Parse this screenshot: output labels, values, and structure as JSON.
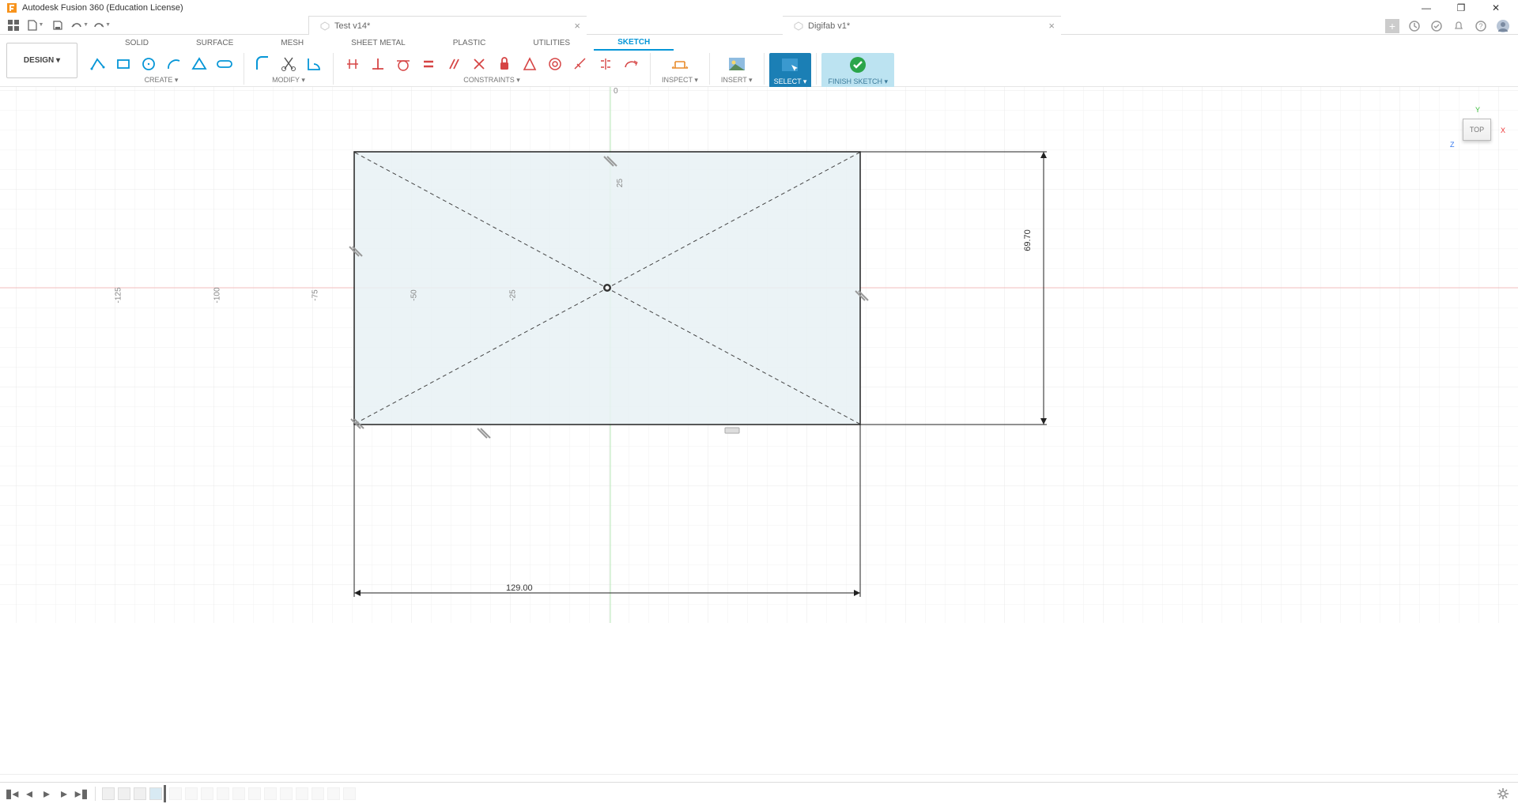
{
  "title_bar": {
    "title": "Autodesk Fusion 360 (Education License)"
  },
  "doc_tabs": {
    "tab1": {
      "label": "Test v14*"
    },
    "tab2": {
      "label": "Digifab v1*"
    }
  },
  "design_button": {
    "label": "DESIGN ▾"
  },
  "ribbon_tabs": {
    "solid": "SOLID",
    "surface": "SURFACE",
    "mesh": "MESH",
    "sheet_metal": "SHEET METAL",
    "plastic": "PLASTIC",
    "utilities": "UTILITIES",
    "sketch": "SKETCH"
  },
  "ribbon_groups": {
    "create": "CREATE ▾",
    "modify": "MODIFY ▾",
    "constraints": "CONSTRAINTS ▾",
    "inspect": "INSPECT ▾",
    "insert": "INSERT ▾",
    "select": "SELECT ▾",
    "finish_sketch": "FINISH SKETCH ▾"
  },
  "viewcube": {
    "face": "TOP",
    "y": "Y",
    "x": "X",
    "z": "Z"
  },
  "canvas": {
    "ruler": {
      "n125": "-125",
      "n100": "-100",
      "n75": "-75",
      "n50": "-50",
      "n25": "-25",
      "zero": "0",
      "p25": "25"
    },
    "dims": {
      "width": "129.00",
      "height": "69.70"
    }
  }
}
